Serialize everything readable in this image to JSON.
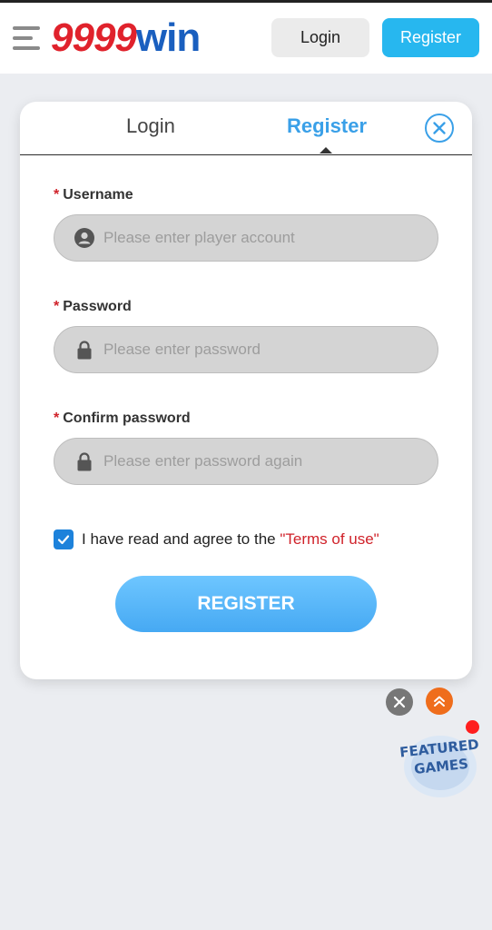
{
  "header": {
    "logo_number": "9999",
    "logo_word": "win",
    "login_label": "Login",
    "register_label": "Register"
  },
  "modal": {
    "tab_login": "Login",
    "tab_register": "Register",
    "username_label": "Username",
    "username_placeholder": "Please enter player account",
    "password_label": "Password",
    "password_placeholder": "Please enter password",
    "confirm_label": "Confirm password",
    "confirm_placeholder": "Please enter password again",
    "required_mark": "*",
    "agree_text": "I have read and agree to the ",
    "terms_text": "\"Terms of use\"",
    "submit_label": "REGISTER"
  },
  "floating": {
    "featured_line1": "FEATURED",
    "featured_line2": "GAMES"
  },
  "colors": {
    "accent_blue": "#27b7ef",
    "tab_active": "#3aa0e8",
    "logo_red": "#e0222c",
    "logo_blue": "#1a5fbf",
    "required_red": "#d0222a"
  }
}
